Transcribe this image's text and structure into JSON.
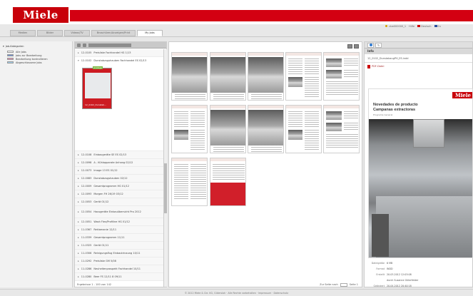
{
  "header": {
    "logo": "Miele",
    "user": "ckw000000_1",
    "help": "Hilfe",
    "language": "Deutsch",
    "language2": "En"
  },
  "tabs": [
    {
      "label": "Medien"
    },
    {
      "label": "Bilder"
    },
    {
      "label": "Videos/TV"
    },
    {
      "label": "Broschüren/Anzeigen/Print"
    },
    {
      "label": "My Jobs"
    }
  ],
  "sidebar": {
    "root": "Job-Kategorien",
    "items": [
      {
        "label": "Alle Jobs",
        "color": "#ffffff"
      },
      {
        "label": "Jobs zur Bearbeitung",
        "color": "#6c8fd6"
      },
      {
        "label": "Bearbeitung kontrollieren",
        "color": "#e48fb0"
      },
      {
        "label": "Abgeschlossene Jobs",
        "color": "#9fd0f0"
      }
    ]
  },
  "list": {
    "rows": [
      {
        "id": "12-0105",
        "title": "Preisliste Fachhandel HG 1/13"
      },
      {
        "id": "12-0102",
        "title": "Dunstabzugshauben Fachhandel ES 02/13",
        "selected": true,
        "thumb_label": "12_0102_Dunstab...",
        "badge": "Anzeige"
      },
      {
        "id": "12-0108",
        "title": "Einbaugeräte SE ES 02/13"
      },
      {
        "id": "12-0098",
        "title": "A - Kühlapparate Anhang 02/12"
      },
      {
        "id": "12-0073",
        "title": "Image 13 ES 01/12"
      },
      {
        "id": "12-0083",
        "title": "Dunstabzugshauben 02/12"
      },
      {
        "id": "12-0009",
        "title": "Gesamtprogramm HG 01/12"
      },
      {
        "id": "12-0093",
        "title": "Morgen FH 26/19 03/12"
      },
      {
        "id": "12-0053",
        "title": "Gerät 01/12"
      },
      {
        "id": "12-0054",
        "title": "Hausgeräte Einbauübersicht Pro 2012",
        "tall": true
      },
      {
        "id": "12-0051",
        "title": "Wash Flex/Profiline HG 01/12"
      },
      {
        "id": "11-0367",
        "title": "Reklamanie 12/11"
      },
      {
        "id": "11-0339",
        "title": "Gesamtprogramm 11/11"
      },
      {
        "id": "11-0325",
        "title": "Gerät 01/11"
      },
      {
        "id": "11-0306",
        "title": "Reinigungsflug Einbautrinaung 10/11"
      },
      {
        "id": "11-0292",
        "title": "Preisliste GM 5/08"
      },
      {
        "id": "11-0286",
        "title": "Neuheitenprospekt Fachhandel 10/11"
      },
      {
        "id": "11-0280",
        "title": "Beer FS 12/11 8 09/11"
      }
    ],
    "pager": "Ergebnisse 1 - 100 von 142"
  },
  "center": {
    "pager_label": "Zur Seite nach",
    "pager_value": "Seite 1"
  },
  "right": {
    "panel_title": "Info",
    "filename": "12_0102_DunstabzugPH_ES.indd",
    "link_label": "PDF-Datei",
    "preview": {
      "logo": "Miele",
      "title1": "Novedades de producto",
      "title2": "Campanas extractoras",
      "subtitle": "Programa General"
    },
    "meta": [
      {
        "key": "Dateigröße",
        "value": "6 MB"
      },
      {
        "key": "Format",
        "value": "INDD"
      },
      {
        "key": "Erstellt",
        "value": "20.03.2012 12:03:08"
      },
      {
        "key": "",
        "value": "durch Susanne Güterfelder"
      },
      {
        "key": "Geändert",
        "value": "20.04.2012 20:40:18"
      },
      {
        "key": "",
        "value": "durch Gertrud Schwarz"
      }
    ]
  },
  "footer": {
    "text": "© 2012 Miele & Cie. KG, Gütersloh · Alle Rechte vorbehalten · Impressum · Datenschutz"
  }
}
